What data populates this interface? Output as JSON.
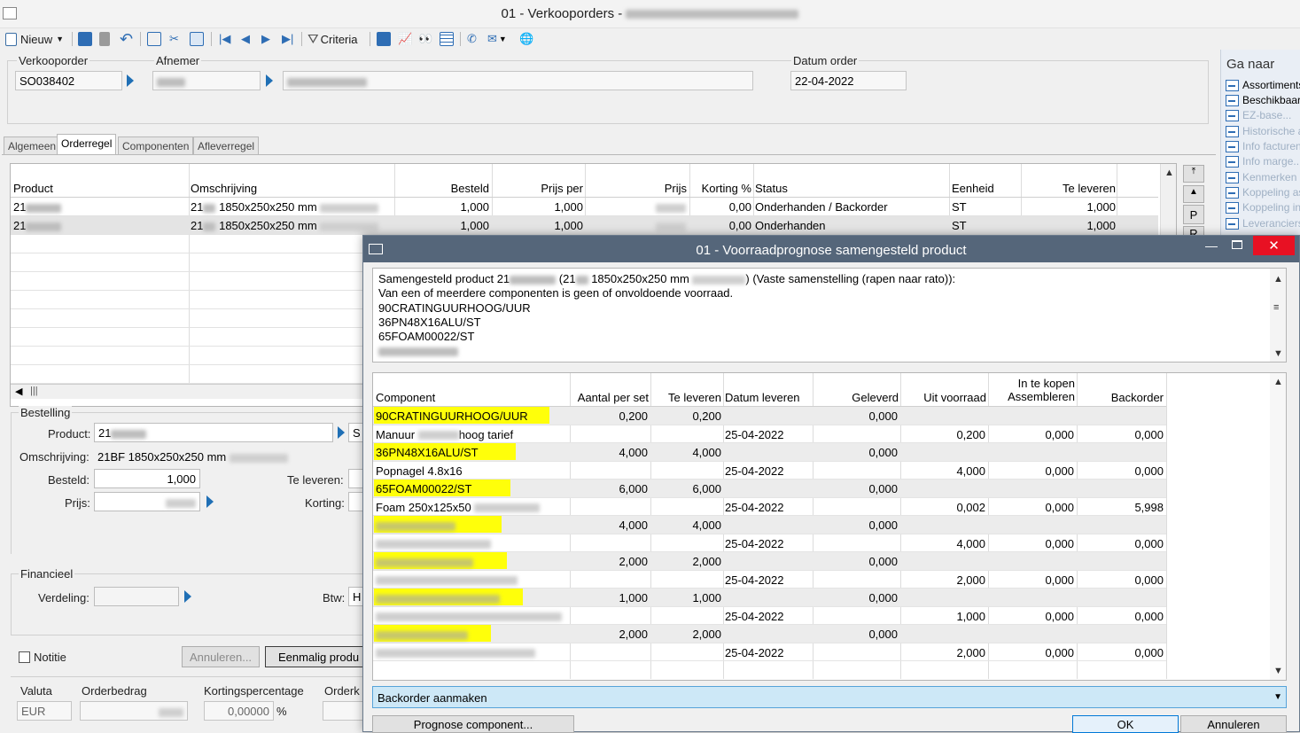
{
  "window": {
    "title": "01 - Verkooporders - "
  },
  "toolbar": {
    "new_label": "Nieuw",
    "criteria_label": "Criteria"
  },
  "header": {
    "verkooporder_label": "Verkooporder",
    "verkooporder_value": "SO038402",
    "afnemer_label": "Afnemer",
    "datum_order_label": "Datum order",
    "datum_order_value": "22-04-2022"
  },
  "tabs": [
    {
      "label": "Algemeen",
      "active": false
    },
    {
      "label": "Orderregel",
      "active": true
    },
    {
      "label": "Componenten",
      "active": false
    },
    {
      "label": "Afleverregel",
      "active": false
    }
  ],
  "main_table": {
    "columns": [
      "Product",
      "Omschrijving",
      "Besteld",
      "Prijs per",
      "Prijs",
      "Korting %",
      "Status",
      "Eenheid",
      "Te leveren"
    ],
    "rows": [
      {
        "product": "21",
        "omschrijving": "21",
        "omschrijving_size": "1850x250x250 mm",
        "besteld": "1,000",
        "prijs_per": "1,000",
        "korting": "0,00",
        "status": "Onderhanden / Backorder",
        "eenheid": "ST",
        "te_leveren": "1,000"
      },
      {
        "product": "21",
        "omschrijving": "21",
        "omschrijving_size": "1850x250x250 mm",
        "besteld": "1,000",
        "prijs_per": "1,000",
        "korting": "0,00",
        "status": "Onderhanden",
        "eenheid": "ST",
        "te_leveren": "1,000"
      }
    ],
    "side_buttons": [
      "P",
      "R"
    ]
  },
  "ga_naar": {
    "title": "Ga naar",
    "items": [
      {
        "label": "Assortiments",
        "enabled": true
      },
      {
        "label": "Beschikbaar",
        "enabled": true
      },
      {
        "label": "EZ-base...",
        "enabled": false
      },
      {
        "label": "Historische a",
        "enabled": false
      },
      {
        "label": "Info facturen",
        "enabled": false
      },
      {
        "label": "Info marge...",
        "enabled": false
      },
      {
        "label": "Kenmerken p",
        "enabled": false
      },
      {
        "label": "Koppeling as",
        "enabled": false
      },
      {
        "label": "Koppeling inl",
        "enabled": false
      },
      {
        "label": "Leveranciers",
        "enabled": false
      }
    ]
  },
  "bestelling": {
    "section_label": "Bestelling",
    "product_label": "Product:",
    "product_value": "21",
    "omschrijving_label": "Omschrijving:",
    "omschrijving_value": "21BF 1850x250x250 mm",
    "besteld_label": "Besteld:",
    "besteld_value": "1,000",
    "te_leveren_label": "Te leveren:",
    "prijs_label": "Prijs:",
    "korting_label": "Korting:",
    "s_label": "S"
  },
  "financieel": {
    "section_label": "Financieel",
    "verdeling_label": "Verdeling:",
    "btw_label": "Btw:",
    "btw_value": "H"
  },
  "footer": {
    "notitie_label": "Notitie",
    "annuleren_label": "Annuleren...",
    "eenmalig_label": "Eenmalig produ",
    "valuta_label": "Valuta",
    "valuta_value": "EUR",
    "orderbedrag_label": "Orderbedrag",
    "kortingspercentage_label": "Kortingspercentage",
    "kortingspercentage_value": "0,00000",
    "percent_sign": "%",
    "orderk_label": "Orderk"
  },
  "dialog": {
    "title": "01 - Voorraadprognose samengesteld product",
    "message_line1_prefix": "Samengesteld product 21",
    "message_line1_mid": "(21",
    "message_line1_size": "1850x250x250 mm",
    "message_line1_suffix": ") (Vaste samenstelling (rapen naar rato)):",
    "message_line2": "Van een of meerdere componenten is geen of onvoldoende voorraad.",
    "message_lines": [
      "90CRATINGUURHOOG/UUR",
      "36PN48X16ALU/ST",
      "65FOAM00022/ST"
    ],
    "columns": {
      "component": "Component",
      "aantal_per_set": "Aantal per set",
      "te_leveren": "Te leveren",
      "datum_leveren": "Datum leveren",
      "geleverd": "Geleverd",
      "uit_voorraad": "Uit voorraad",
      "in_te_kopen": "In te kopen",
      "assembleren": "Assembleren",
      "backorder": "Backorder"
    },
    "rows": [
      {
        "type": "component",
        "component": "90CRATINGUURHOOG/UUR",
        "aantal": "0,200",
        "te_leveren": "0,200",
        "geleverd": "0,000"
      },
      {
        "type": "detail",
        "component": "Manuur",
        "component_suffix": "hoog tarief",
        "datum": "25-04-2022",
        "uit_voorraad": "0,200",
        "in_te_kopen": "0,000",
        "backorder": "0,000"
      },
      {
        "type": "component",
        "component": "36PN48X16ALU/ST",
        "aantal": "4,000",
        "te_leveren": "4,000",
        "geleverd": "0,000"
      },
      {
        "type": "detail",
        "component": "Popnagel 4.8x16",
        "datum": "25-04-2022",
        "uit_voorraad": "4,000",
        "in_te_kopen": "0,000",
        "backorder": "0,000"
      },
      {
        "type": "component",
        "component": "65FOAM00022/ST",
        "aantal": "6,000",
        "te_leveren": "6,000",
        "geleverd": "0,000"
      },
      {
        "type": "detail",
        "component": "Foam 250x125x50",
        "datum": "25-04-2022",
        "uit_voorraad": "0,002",
        "in_te_kopen": "0,000",
        "backorder": "5,998"
      },
      {
        "type": "component",
        "component": "",
        "aantal": "4,000",
        "te_leveren": "4,000",
        "geleverd": "0,000"
      },
      {
        "type": "detail",
        "component": "",
        "datum": "25-04-2022",
        "uit_voorraad": "4,000",
        "in_te_kopen": "0,000",
        "backorder": "0,000"
      },
      {
        "type": "component",
        "component": "",
        "aantal": "2,000",
        "te_leveren": "2,000",
        "geleverd": "0,000"
      },
      {
        "type": "detail",
        "component": "",
        "datum": "25-04-2022",
        "uit_voorraad": "2,000",
        "in_te_kopen": "0,000",
        "backorder": "0,000"
      },
      {
        "type": "component",
        "component": "",
        "aantal": "1,000",
        "te_leveren": "1,000",
        "geleverd": "0,000"
      },
      {
        "type": "detail",
        "component": "",
        "datum": "25-04-2022",
        "uit_voorraad": "1,000",
        "in_te_kopen": "0,000",
        "backorder": "0,000"
      },
      {
        "type": "component",
        "component": "",
        "aantal": "2,000",
        "te_leveren": "2,000",
        "geleverd": "0,000"
      },
      {
        "type": "detail",
        "component": "",
        "datum": "25-04-2022",
        "uit_voorraad": "2,000",
        "in_te_kopen": "0,000",
        "backorder": "0,000"
      }
    ],
    "action_select_value": "Backorder aanmaken",
    "prognose_button": "Prognose component...",
    "ok_button": "OK",
    "annuleren_button": "Annuleren"
  },
  "colors": {
    "highlight": "#ffff0a",
    "dialog_title": "#55667a",
    "select_bg": "#cde8f7",
    "close_button": "#e81123"
  }
}
